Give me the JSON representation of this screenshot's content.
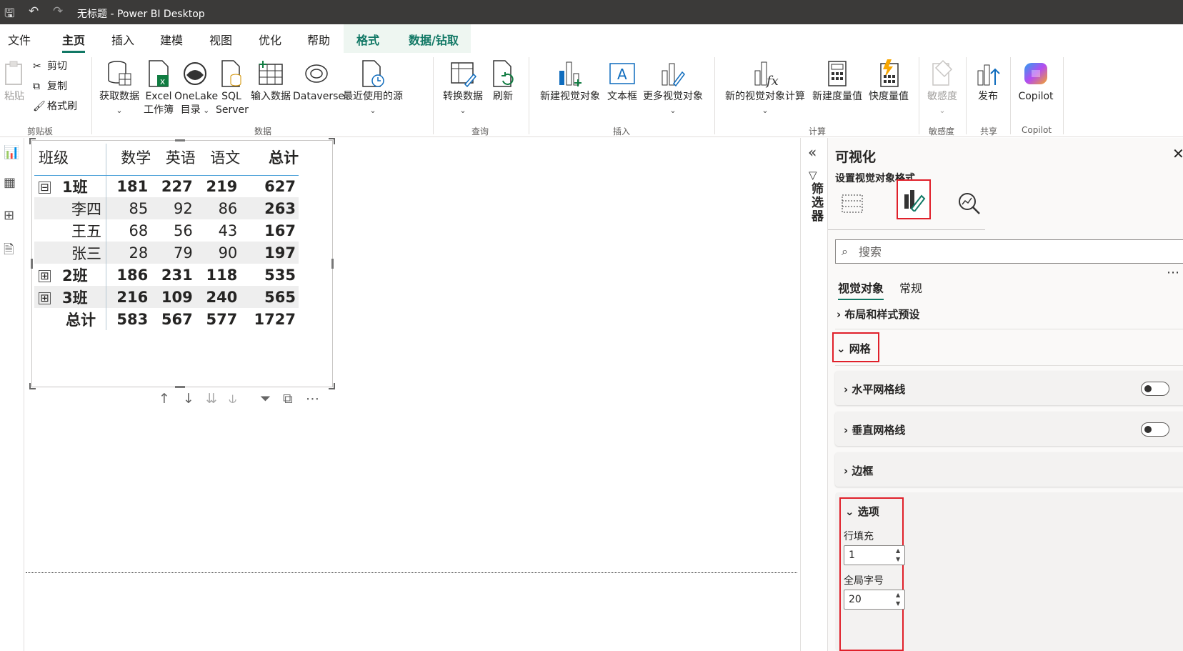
{
  "window": {
    "title": "无标题 - Power BI Desktop"
  },
  "menu_tabs": [
    "文件",
    "主页",
    "插入",
    "建模",
    "视图",
    "优化",
    "帮助",
    "格式",
    "数据/钻取"
  ],
  "ribbon": {
    "clipboard": {
      "paste": "粘贴",
      "cut": "剪切",
      "copy": "复制",
      "format_painter": "格式刷",
      "group": "剪贴板"
    },
    "data": {
      "get_data": "获取数据",
      "excel_1": "Excel",
      "excel_2": "工作簿",
      "onelake_1": "OneLake",
      "onelake_2": "目录",
      "sql_1": "SQL",
      "sql_2": "Server",
      "enter_data": "输入数据",
      "dataverse": "Dataverse",
      "recent": "最近使用的源",
      "group": "数据"
    },
    "queries": {
      "transform": "转换数据",
      "refresh": "刷新",
      "group": "查询"
    },
    "insert": {
      "new_visual": "新建视觉对象",
      "textbox": "文本框",
      "more_visuals": "更多视觉对象",
      "group": "插入"
    },
    "calc": {
      "new_visual_calc": "新的视觉对象计算",
      "new_measure": "新建度量值",
      "quick_measure": "快度量值",
      "group": "计算"
    },
    "sensitivity": {
      "label": "敏感度",
      "group": "敏感度"
    },
    "share": {
      "publish": "发布",
      "group": "共享"
    },
    "copilot": {
      "label": "Copilot",
      "group": "Copilot"
    }
  },
  "matrix": {
    "headers": [
      "班级",
      "数学",
      "英语",
      "语文",
      "总计"
    ],
    "rows": [
      {
        "label": "1班",
        "values": [
          "181",
          "227",
          "219",
          "627"
        ],
        "toggle": "⊟"
      },
      {
        "label": "李四",
        "values": [
          "85",
          "92",
          "86",
          "263"
        ]
      },
      {
        "label": "王五",
        "values": [
          "68",
          "56",
          "43",
          "167"
        ]
      },
      {
        "label": "张三",
        "values": [
          "28",
          "79",
          "90",
          "197"
        ]
      },
      {
        "label": "2班",
        "values": [
          "186",
          "231",
          "118",
          "535"
        ],
        "toggle": "⊞"
      },
      {
        "label": "3班",
        "values": [
          "216",
          "109",
          "240",
          "565"
        ],
        "toggle": "⊞"
      },
      {
        "label": "总计",
        "values": [
          "583",
          "567",
          "577",
          "1727"
        ]
      }
    ]
  },
  "filters_pane": {
    "label": "筛选器"
  },
  "viz_pane": {
    "title": "可视化",
    "subtitle": "设置视觉对象格式",
    "search_placeholder": "搜索",
    "tabs": [
      "视觉对象",
      "常规"
    ],
    "sections": {
      "layout_presets": "布局和样式预设",
      "grid": "网格",
      "horizontal_gridlines": "水平网格线",
      "vertical_gridlines": "垂直网格线",
      "border": "边框",
      "options": "选项",
      "row_padding_label": "行填充",
      "row_padding_value": "1",
      "global_font_label": "全局字号",
      "global_font_value": "20"
    }
  },
  "colors": {
    "accent": "#117865",
    "highlight": "#e0202a",
    "titlebar": "#3b3a39"
  }
}
